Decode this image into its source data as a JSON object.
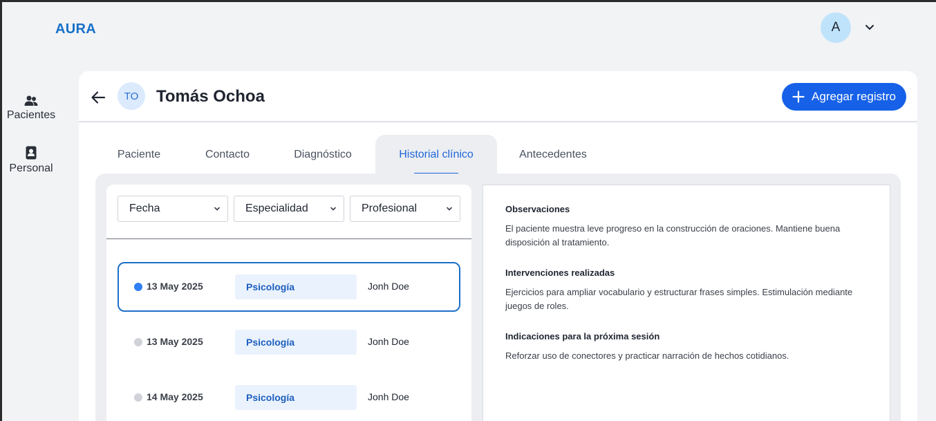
{
  "app": {
    "brand": "AURA"
  },
  "user": {
    "avatar_initial": "A",
    "caret_icon": "chevron-down-icon"
  },
  "sidebar": {
    "items": [
      {
        "label": "Pacientes",
        "icon": "users-icon"
      },
      {
        "label": "Personal",
        "icon": "id-badge-icon"
      }
    ]
  },
  "patient": {
    "initials": "TO",
    "name": "Tomás Ochoa",
    "add_record_label": "Agregar registro"
  },
  "tabs": [
    {
      "label": "Paciente",
      "active": false
    },
    {
      "label": "Contacto",
      "active": false
    },
    {
      "label": "Diagnóstico",
      "active": false
    },
    {
      "label": "Historial clínico",
      "active": true
    },
    {
      "label": "Antecedentes",
      "active": false
    }
  ],
  "filters": [
    {
      "label": "Fecha"
    },
    {
      "label": "Especialidad"
    },
    {
      "label": "Profesional"
    }
  ],
  "records": [
    {
      "date": "13 May 2025",
      "specialty": "Psicología",
      "professional": "Jonh Doe",
      "selected": true
    },
    {
      "date": "13 May 2025",
      "specialty": "Psicología",
      "professional": "Jonh Doe",
      "selected": false
    },
    {
      "date": "14 May 2025",
      "specialty": "Psicología",
      "professional": "Jonh Doe",
      "selected": false
    }
  ],
  "detail": {
    "sections": [
      {
        "title": "Observaciones",
        "body": "El paciente muestra leve progreso en la construcción de oraciones. Mantiene buena disposición al tratamiento."
      },
      {
        "title": "Intervenciones realizadas",
        "body": "Ejercicios para ampliar vocabulario y estructurar frases simples. Estimulación mediante juegos de roles."
      },
      {
        "title": "Indicaciones para la próxima sesión",
        "body": "Reforzar uso de conectores y practicar narración de hechos cotidianos."
      }
    ]
  },
  "colors": {
    "accent": "#1661e8",
    "brand": "#1670c9",
    "selected_dot": "#2f7ef5",
    "inactive_dot": "#cfd3d9"
  }
}
